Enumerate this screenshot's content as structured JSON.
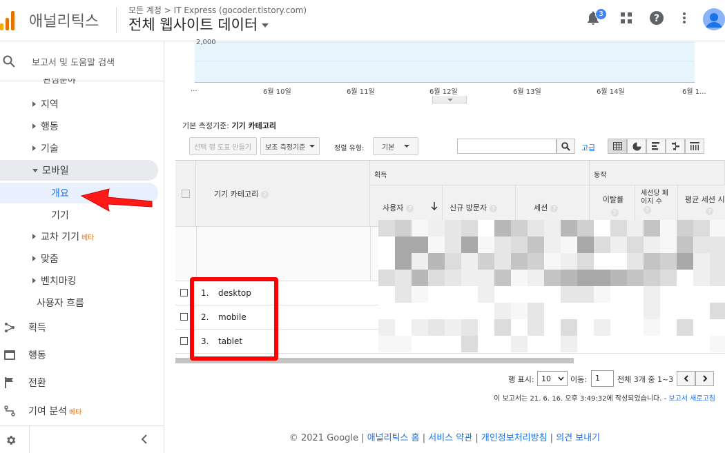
{
  "header": {
    "app_name": "애널리틱스",
    "breadcrumb": "모든 계정 > IT Express (gocoder.tistory.com)",
    "view_title": "전체 웹사이트 데이터",
    "notification_count": "3",
    "logo_colors": [
      "#f9ab00",
      "#e37400",
      "#e37400"
    ]
  },
  "sidebar": {
    "search_placeholder": "보고서 및 도움말 검색",
    "partial_item": "관심분야",
    "items": [
      {
        "label": "지역"
      },
      {
        "label": "행동"
      },
      {
        "label": "기술"
      },
      {
        "label": "모바일"
      },
      {
        "label": "개요"
      },
      {
        "label": "기기"
      },
      {
        "label": "교차 기기",
        "badge": "베타"
      },
      {
        "label": "맞춤"
      },
      {
        "label": "벤치마킹"
      },
      {
        "label": "사용자 흐름"
      }
    ],
    "main_nav": [
      {
        "label": "획득"
      },
      {
        "label": "행동"
      },
      {
        "label": "전환"
      },
      {
        "label": "기여 분석",
        "badge": "베타"
      }
    ]
  },
  "chart": {
    "ytick": "2,000",
    "xticks": [
      "...",
      "6월 10일",
      "6월 11일",
      "6월 12일",
      "6월 13일",
      "6월 14일",
      "6월 1..."
    ]
  },
  "dimension": {
    "prefix": "기본 측정기준:",
    "value": "기기 카테고리"
  },
  "toolbar": {
    "create_chart": "선택 행 도표 만들기",
    "secondary_dim": "보조 측정기준",
    "sort_type_label": "정렬 유형:",
    "sort_value": "기본",
    "advanced": "고급"
  },
  "table": {
    "dim_header": "기기 카테고리",
    "group_acquisition": "획득",
    "group_behavior": "동작",
    "columns": [
      "사용자",
      "신규 방문자",
      "세션",
      "이탈률",
      "세션당 페이지 수",
      "평균 세션 시"
    ],
    "rows": [
      {
        "rank": "1.",
        "device": "desktop"
      },
      {
        "rank": "2.",
        "device": "mobile"
      },
      {
        "rank": "3.",
        "device": "tablet"
      }
    ]
  },
  "pager": {
    "rows_label": "행 표시:",
    "rows_value": "10",
    "goto_label": "이동:",
    "goto_value": "1",
    "range": "전체 3개 중 1~3",
    "generated": "이 보고서는 21. 6. 16. 오후 3:49:32에 작성되었습니다.",
    "refresh": "보고서 새로고침"
  },
  "footer": {
    "copyright": "© 2021 Google",
    "links": [
      "애널리틱스 홈",
      "서비스 약관",
      "개인정보처리방침",
      "의견 보내기"
    ]
  }
}
